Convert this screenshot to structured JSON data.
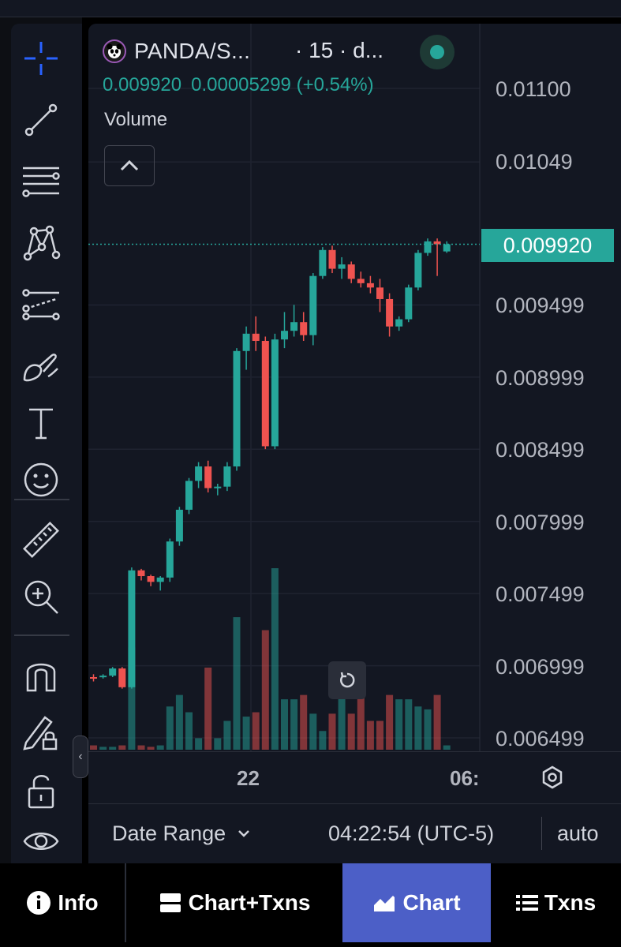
{
  "header": {
    "symbol": "PANDA/S...",
    "interval": "· 15 · d...",
    "last_price_text": "0.009920",
    "change_text": "0.00005299 (+0.54%)"
  },
  "study": {
    "volume_label": "Volume"
  },
  "toolbar": {
    "tools": [
      {
        "name": "crosshair-icon"
      },
      {
        "name": "trend-line-icon"
      },
      {
        "name": "fib-retracement-icon"
      },
      {
        "name": "pattern-icon"
      },
      {
        "name": "prediction-icon"
      },
      {
        "name": "brush-icon"
      },
      {
        "name": "text-icon"
      },
      {
        "name": "emoji-icon"
      },
      {
        "name": "ruler-icon"
      },
      {
        "name": "zoom-in-icon"
      },
      {
        "name": "magnet-icon"
      },
      {
        "name": "lock-drawing-icon"
      },
      {
        "name": "lock-icon"
      },
      {
        "name": "eye-icon"
      }
    ]
  },
  "price_axis": {
    "labels": [
      "0.01100",
      "0.01049",
      "0.009499",
      "0.008999",
      "0.008499",
      "0.007999",
      "0.007499",
      "0.006999",
      "0.006499"
    ],
    "last_price_badge": "0.009920"
  },
  "time_axis": {
    "labels": [
      "22",
      "06:"
    ]
  },
  "footer": {
    "date_range_label": "Date Range",
    "clock": "04:22:54 (UTC-5)",
    "scale_mode": "auto"
  },
  "tabs": [
    {
      "label": "Info",
      "active": false
    },
    {
      "label": "Chart+Txns",
      "active": false
    },
    {
      "label": "Chart",
      "active": true
    },
    {
      "label": "Txns",
      "active": false
    }
  ],
  "colors": {
    "up": "#26a69a",
    "down": "#ef5350",
    "background": "#131722",
    "active_tab": "#4c5fc7"
  },
  "chart_data": {
    "type": "candlestick",
    "price_range": [
      0.0064,
      0.0111
    ],
    "last_price": 0.00992,
    "candles": [
      {
        "o": 0.00692,
        "h": 0.00694,
        "l": 0.00689,
        "c": 0.00691,
        "v": 0.03
      },
      {
        "o": 0.00692,
        "h": 0.00694,
        "l": 0.00691,
        "c": 0.00693,
        "v": 0.02
      },
      {
        "o": 0.00693,
        "h": 0.00699,
        "l": 0.00692,
        "c": 0.00698,
        "v": 0.02
      },
      {
        "o": 0.00698,
        "h": 0.00699,
        "l": 0.00684,
        "c": 0.00685,
        "v": 0.03
      },
      {
        "o": 0.00685,
        "h": 0.00768,
        "l": 0.00684,
        "c": 0.00766,
        "v": 0.71
      },
      {
        "o": 0.00766,
        "h": 0.00767,
        "l": 0.00759,
        "c": 0.00762,
        "v": 0.03
      },
      {
        "o": 0.00762,
        "h": 0.00763,
        "l": 0.00755,
        "c": 0.00758,
        "v": 0.02
      },
      {
        "o": 0.00758,
        "h": 0.00762,
        "l": 0.00752,
        "c": 0.00761,
        "v": 0.03
      },
      {
        "o": 0.00761,
        "h": 0.00788,
        "l": 0.00758,
        "c": 0.00786,
        "v": 0.3
      },
      {
        "o": 0.00786,
        "h": 0.0081,
        "l": 0.00783,
        "c": 0.00808,
        "v": 0.38
      },
      {
        "o": 0.00808,
        "h": 0.0083,
        "l": 0.00805,
        "c": 0.00828,
        "v": 0.26
      },
      {
        "o": 0.00828,
        "h": 0.00841,
        "l": 0.00823,
        "c": 0.00838,
        "v": 0.08
      },
      {
        "o": 0.00838,
        "h": 0.00842,
        "l": 0.0082,
        "c": 0.00823,
        "v": 0.57
      },
      {
        "o": 0.00823,
        "h": 0.00826,
        "l": 0.00818,
        "c": 0.00824,
        "v": 0.08
      },
      {
        "o": 0.00824,
        "h": 0.00841,
        "l": 0.00821,
        "c": 0.00838,
        "v": 0.2
      },
      {
        "o": 0.00838,
        "h": 0.0092,
        "l": 0.00835,
        "c": 0.00918,
        "v": 0.92
      },
      {
        "o": 0.00918,
        "h": 0.00935,
        "l": 0.00905,
        "c": 0.0093,
        "v": 0.23
      },
      {
        "o": 0.0093,
        "h": 0.00942,
        "l": 0.00918,
        "c": 0.00925,
        "v": 0.26
      },
      {
        "o": 0.00925,
        "h": 0.00928,
        "l": 0.0085,
        "c": 0.00852,
        "v": 0.83
      },
      {
        "o": 0.00852,
        "h": 0.0093,
        "l": 0.0085,
        "c": 0.00926,
        "v": 1.26
      },
      {
        "o": 0.00926,
        "h": 0.00945,
        "l": 0.0092,
        "c": 0.00932,
        "v": 0.35
      },
      {
        "o": 0.00932,
        "h": 0.0095,
        "l": 0.00928,
        "c": 0.00938,
        "v": 0.35
      },
      {
        "o": 0.00938,
        "h": 0.00945,
        "l": 0.00925,
        "c": 0.00929,
        "v": 0.38
      },
      {
        "o": 0.00929,
        "h": 0.00972,
        "l": 0.00922,
        "c": 0.0097,
        "v": 0.25
      },
      {
        "o": 0.0097,
        "h": 0.0099,
        "l": 0.00968,
        "c": 0.00988,
        "v": 0.13
      },
      {
        "o": 0.00988,
        "h": 0.00991,
        "l": 0.00972,
        "c": 0.00975,
        "v": 0.25
      },
      {
        "o": 0.00975,
        "h": 0.00983,
        "l": 0.00968,
        "c": 0.00978,
        "v": 0.38
      },
      {
        "o": 0.00978,
        "h": 0.0098,
        "l": 0.00965,
        "c": 0.00968,
        "v": 0.25
      },
      {
        "o": 0.00968,
        "h": 0.00973,
        "l": 0.00962,
        "c": 0.00965,
        "v": 0.38
      },
      {
        "o": 0.00965,
        "h": 0.0097,
        "l": 0.00958,
        "c": 0.00962,
        "v": 0.2
      },
      {
        "o": 0.00962,
        "h": 0.00968,
        "l": 0.00945,
        "c": 0.00954,
        "v": 0.2
      },
      {
        "o": 0.00954,
        "h": 0.00958,
        "l": 0.00928,
        "c": 0.00935,
        "v": 0.38
      },
      {
        "o": 0.00935,
        "h": 0.00942,
        "l": 0.00932,
        "c": 0.0094,
        "v": 0.35
      },
      {
        "o": 0.0094,
        "h": 0.00964,
        "l": 0.00938,
        "c": 0.00962,
        "v": 0.35
      },
      {
        "o": 0.00962,
        "h": 0.00988,
        "l": 0.0096,
        "c": 0.00986,
        "v": 0.3
      },
      {
        "o": 0.00986,
        "h": 0.00996,
        "l": 0.00984,
        "c": 0.00994,
        "v": 0.28
      },
      {
        "o": 0.00994,
        "h": 0.00996,
        "l": 0.0097,
        "c": 0.00992,
        "v": 0.38
      },
      {
        "o": 0.00987,
        "h": 0.00994,
        "l": 0.00986,
        "c": 0.00992,
        "v": 0.03
      }
    ]
  }
}
